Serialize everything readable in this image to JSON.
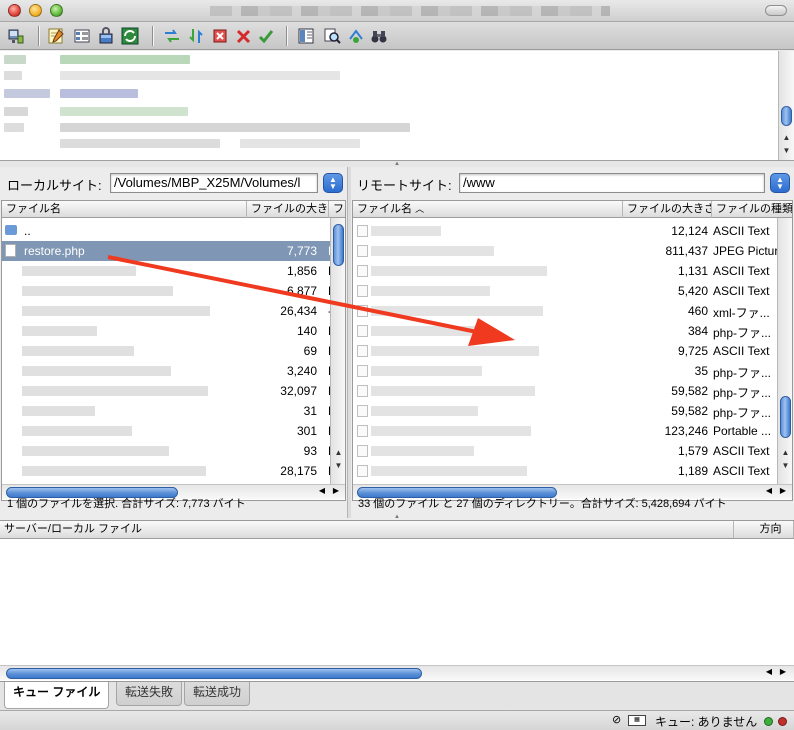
{
  "colors": {
    "selection": "#7f96b4",
    "accent_blue": "#2c6cd0",
    "annotation_arrow": "#f03a20"
  },
  "toolbar": {
    "icons": [
      "site-manager-icon",
      "edit-icon",
      "list-icon",
      "lock-icon",
      "refresh-icon",
      "process-queue-icon",
      "transfer-icon",
      "cancel-icon",
      "disconnect-icon",
      "reconnect-icon",
      "toggle-view-icon",
      "find-icon",
      "compare-icon",
      "binoculars-icon"
    ]
  },
  "local": {
    "label": "ローカルサイト:",
    "path": "/Volumes/MBP_X25M/Volumes/l",
    "columns": [
      "ファイル名",
      "ファイルの大きさ",
      "ファ"
    ],
    "rows": [
      {
        "name": "..",
        "size": "",
        "type": ""
      },
      {
        "name": "restore.php",
        "size": "7,773",
        "type": "P"
      },
      {
        "name": "",
        "size": "1,856",
        "type": "P"
      },
      {
        "name": "",
        "size": "6,877",
        "type": "P"
      },
      {
        "name": "",
        "size": "26,434",
        "type": "-"
      },
      {
        "name": "",
        "size": "140",
        "type": "P"
      },
      {
        "name": "",
        "size": "69",
        "type": "P"
      },
      {
        "name": "",
        "size": "3,240",
        "type": "P"
      },
      {
        "name": "",
        "size": "32,097",
        "type": "H"
      },
      {
        "name": "",
        "size": "31",
        "type": "P"
      },
      {
        "name": "",
        "size": "301",
        "type": "P"
      },
      {
        "name": "",
        "size": "93",
        "type": "H"
      },
      {
        "name": "",
        "size": "28,175",
        "type": "P"
      }
    ],
    "status": "1 個のファイルを選択. 合計サイズ: 7,773 バイト"
  },
  "remote": {
    "label": "リモートサイト:",
    "path": "/www",
    "columns": [
      "ファイル名",
      "ファイルの大きさ",
      "ファイルの種類"
    ],
    "rows": [
      {
        "size": "12,124",
        "type": "ASCII Text"
      },
      {
        "size": "811,437",
        "type": "JPEG Picture"
      },
      {
        "size": "1,131",
        "type": "ASCII Text"
      },
      {
        "size": "5,420",
        "type": "ASCII Text"
      },
      {
        "size": "460",
        "type": "xml-ファ..."
      },
      {
        "size": "384",
        "type": "php-ファ..."
      },
      {
        "size": "9,725",
        "type": "ASCII Text"
      },
      {
        "size": "35",
        "type": "php-ファ..."
      },
      {
        "size": "59,582",
        "type": "php-ファ..."
      },
      {
        "size": "59,582",
        "type": "php-ファ..."
      },
      {
        "size": "123,246",
        "type": "Portable ..."
      },
      {
        "size": "1,579",
        "type": "ASCII Text"
      },
      {
        "size": "1,189",
        "type": "ASCII Text"
      }
    ],
    "status": "33 個のファイル と 27 個のディレクトリー。合計サイズ: 5,428,694 バイト"
  },
  "queue": {
    "columns": [
      "サーバー/ローカル ファイル",
      "方向"
    ],
    "tabs": [
      "キュー ファイル",
      "転送失敗",
      "転送成功"
    ]
  },
  "statusbar": {
    "queue_text": "キュー: ありません",
    "leds": [
      "#3cae3a",
      "#c0302a"
    ]
  }
}
